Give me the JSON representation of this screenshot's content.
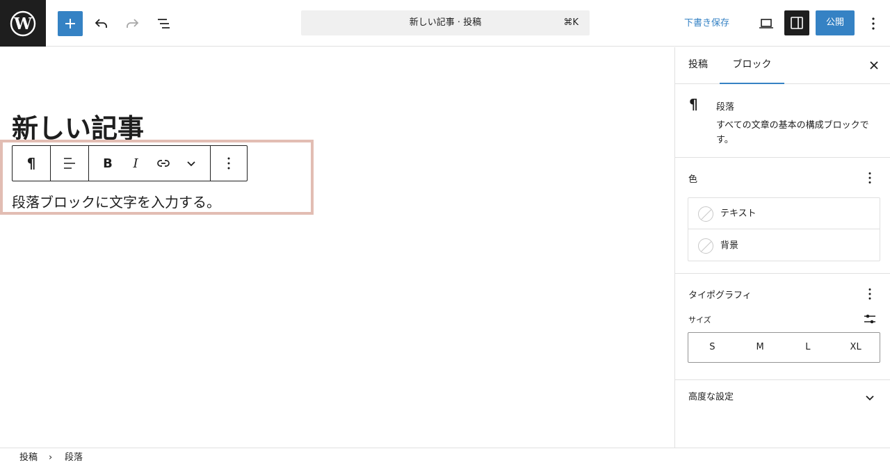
{
  "topbar": {
    "logo_icon": "wordpress-icon",
    "add_block_icon": "plus-icon",
    "undo_icon": "undo-icon",
    "redo_icon": "redo-icon",
    "list_view_icon": "list-view-icon",
    "command_title": "新しい記事 · 投稿",
    "command_shortcut": "⌘K",
    "save_draft_label": "下書き保存",
    "preview_icon": "desktop-preview-icon",
    "settings_icon": "sidebar-toggle-icon",
    "publish_label": "公開",
    "options_icon": "vertical-ellipsis-icon",
    "accent_color": "#3582c4"
  },
  "editor": {
    "post_title": "新しい記事",
    "paragraph_text": "段落ブロックに文字を入力する。",
    "highlight_color": "#e2bdb3",
    "toolbar": {
      "paragraph_icon": "pilcrow-icon",
      "paragraph_glyph": "¶",
      "align_icon": "align-left-icon",
      "bold_glyph": "B",
      "italic_glyph": "I",
      "link_icon": "link-icon",
      "more_rich_text_icon": "chevron-down-icon",
      "block_options_icon": "vertical-ellipsis-icon"
    }
  },
  "sidebar": {
    "tabs": [
      {
        "label": "投稿",
        "active": false
      },
      {
        "label": "ブロック",
        "active": true
      }
    ],
    "close_icon": "close-icon",
    "block_card": {
      "icon_glyph": "¶",
      "title": "段落",
      "description": "すべての文章の基本の構成ブロックです。"
    },
    "color_panel": {
      "title": "色",
      "items": [
        {
          "label": "テキスト"
        },
        {
          "label": "背景"
        }
      ]
    },
    "typography_panel": {
      "title": "タイポグラフィ",
      "size_label": "サイズ",
      "size_options": [
        "S",
        "M",
        "L",
        "XL"
      ]
    },
    "advanced_panel": {
      "title": "高度な設定"
    }
  },
  "footer": {
    "breadcrumb": [
      "投稿",
      "段落"
    ],
    "separator": "›"
  }
}
